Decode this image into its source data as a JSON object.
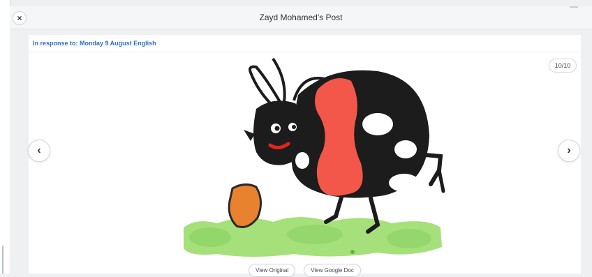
{
  "modal": {
    "title": "Zayd Mohamed's Post",
    "close_symbol": "×"
  },
  "post": {
    "response_label": "In response to: Monday 9 August English",
    "counter": "10/10",
    "prev_symbol": "‹",
    "next_symbol": "›",
    "image_subject": "child's drawing of a ladybird"
  },
  "actions": {
    "view_original": "View Original",
    "view_google_doc": "View Google Doc"
  },
  "colors": {
    "accent_link": "#2f6fc1",
    "drawing_black": "#1c1c1c",
    "drawing_red": "#f2574a",
    "drawing_orange": "#e9822f",
    "drawing_green": "#a6e07a"
  }
}
